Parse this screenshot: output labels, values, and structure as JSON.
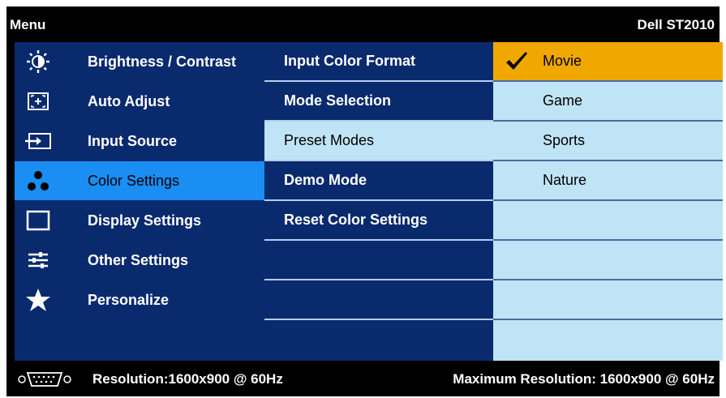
{
  "header": {
    "menu_label": "Menu",
    "model": "Dell ST2010"
  },
  "main_menu": [
    {
      "label": "Brightness / Contrast",
      "icon": "brightness-icon",
      "selected": false
    },
    {
      "label": "Auto Adjust",
      "icon": "auto-adjust-icon",
      "selected": false
    },
    {
      "label": "Input Source",
      "icon": "input-source-icon",
      "selected": false
    },
    {
      "label": "Color Settings",
      "icon": "color-settings-icon",
      "selected": true
    },
    {
      "label": "Display Settings",
      "icon": "display-settings-icon",
      "selected": false
    },
    {
      "label": "Other Settings",
      "icon": "other-settings-icon",
      "selected": false
    },
    {
      "label": "Personalize",
      "icon": "star-icon",
      "selected": false
    }
  ],
  "submenu": [
    {
      "label": "Input Color Format",
      "selected": false
    },
    {
      "label": "Mode Selection",
      "selected": false
    },
    {
      "label": "Preset Modes",
      "selected": true
    },
    {
      "label": "Demo Mode",
      "selected": false
    },
    {
      "label": "Reset Color Settings",
      "selected": false
    },
    {
      "label": "",
      "selected": false
    },
    {
      "label": "",
      "selected": false
    },
    {
      "label": "",
      "selected": false
    }
  ],
  "options": [
    {
      "label": "Movie",
      "selected": true,
      "checked": true
    },
    {
      "label": "Game",
      "selected": false
    },
    {
      "label": "Sports",
      "selected": false
    },
    {
      "label": "Nature",
      "selected": false
    },
    {
      "label": "",
      "selected": false
    },
    {
      "label": "",
      "selected": false
    },
    {
      "label": "",
      "selected": false
    },
    {
      "label": "",
      "selected": false
    }
  ],
  "footer": {
    "connector_icon": "vga-connector-icon",
    "resolution": "Resolution:1600x900 @ 60Hz",
    "max_resolution": "Maximum Resolution: 1600x900 @ 60Hz"
  },
  "colors": {
    "panel_blue": "#0a2a6e",
    "selected_blue": "#1a8ef2",
    "light_blue": "#bfe4f5",
    "highlight_orange": "#f0a800"
  }
}
